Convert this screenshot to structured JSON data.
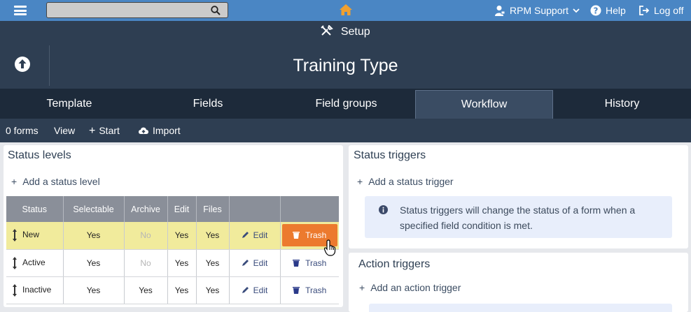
{
  "topbar": {
    "search": {
      "value": "",
      "placeholder": ""
    },
    "user_label": "RPM Support",
    "help_label": "Help",
    "logoff_label": "Log off"
  },
  "header": {
    "setup_label": "Setup",
    "title": "Training Type"
  },
  "tabs": [
    {
      "label": "Template",
      "active": false
    },
    {
      "label": "Fields",
      "active": false
    },
    {
      "label": "Field groups",
      "active": false
    },
    {
      "label": "Workflow",
      "active": true
    },
    {
      "label": "History",
      "active": false
    }
  ],
  "actionbar": {
    "forms_count": "0 forms",
    "view": "View",
    "start": "Start",
    "import": "Import"
  },
  "status_levels": {
    "title": "Status levels",
    "add_label": "Add a status level",
    "columns": [
      "Status",
      "Selectable",
      "Archive",
      "Edit",
      "Files",
      "",
      ""
    ],
    "rows": [
      {
        "status": "New",
        "selectable": "Yes",
        "archive": "No",
        "edit": "Yes",
        "files": "Yes",
        "edit_label": "Edit",
        "trash_label": "Trash"
      },
      {
        "status": "Active",
        "selectable": "Yes",
        "archive": "No",
        "edit": "Yes",
        "files": "Yes",
        "edit_label": "Edit",
        "trash_label": "Trash"
      },
      {
        "status": "Inactive",
        "selectable": "Yes",
        "archive": "Yes",
        "edit": "Yes",
        "files": "Yes",
        "edit_label": "Edit",
        "trash_label": "Trash"
      }
    ]
  },
  "status_triggers": {
    "title": "Status triggers",
    "add_label": "Add a status trigger",
    "info_line1": "Status triggers will change the status of a form when a",
    "info_line2": "specified field condition is met."
  },
  "action_triggers": {
    "title": "Action triggers",
    "add_label": "Add an action trigger"
  },
  "colors": {
    "topbar": "#4a86c4",
    "header": "#2e3e52",
    "tabs": "#1d2a3a",
    "highlight_row": "#f1eb9c",
    "trash_button": "#ec7a2e",
    "home_icon": "#f0a030"
  }
}
